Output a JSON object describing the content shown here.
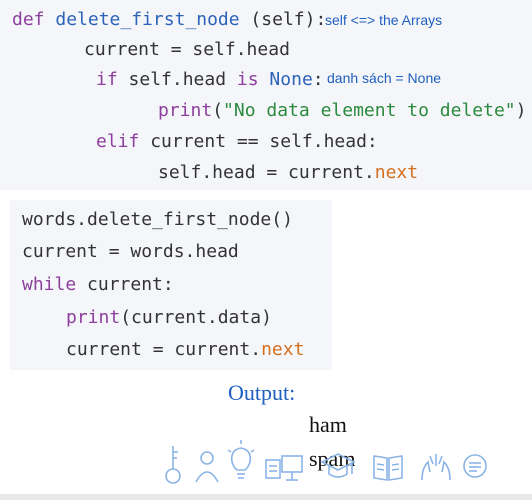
{
  "code_block_1": {
    "line1": {
      "kw_def": "def",
      "fn_name": "delete_first_node",
      "rest": " (self):",
      "annotation": "self <=> the Arrays"
    },
    "line2": "current = self.head",
    "line3": {
      "kw_if": "if",
      "mid": " self.head ",
      "kw_is": "is",
      "none": " None",
      "colon": ":",
      "annotation": "danh sách = None"
    },
    "line4": {
      "print": "print",
      "open": "(",
      "str": "\"No data element to delete\"",
      "close": ")"
    },
    "line5": {
      "kw_elif": "elif",
      "rest": " current == self.head:"
    },
    "line6": {
      "pre": "self.head = current.",
      "attr": "next"
    }
  },
  "code_block_2": {
    "line1": "words.delete_first_node()",
    "line2": "current = words.head",
    "line3": {
      "kw_while": "while",
      "rest": " current:"
    },
    "line4": {
      "print": "print",
      "rest": "(current.data)"
    },
    "line5": {
      "pre": "current = current.",
      "attr": "next"
    }
  },
  "output": {
    "label": "Output:",
    "lines": [
      "ham",
      "spam"
    ]
  },
  "icons": [
    "key-icon",
    "person-icon",
    "lightbulb-icon",
    "presentation-icon",
    "graduation-cap-icon",
    "book-icon",
    "hands-icon",
    "chat-bubble-icon"
  ],
  "colors": {
    "keyword": "#8d3f9d",
    "function_name": "#2c63b8",
    "string": "#2b8a3e",
    "attribute": "#d46f1e",
    "annotation": "#1f5fbf",
    "code_background": "#f4f6f9"
  }
}
